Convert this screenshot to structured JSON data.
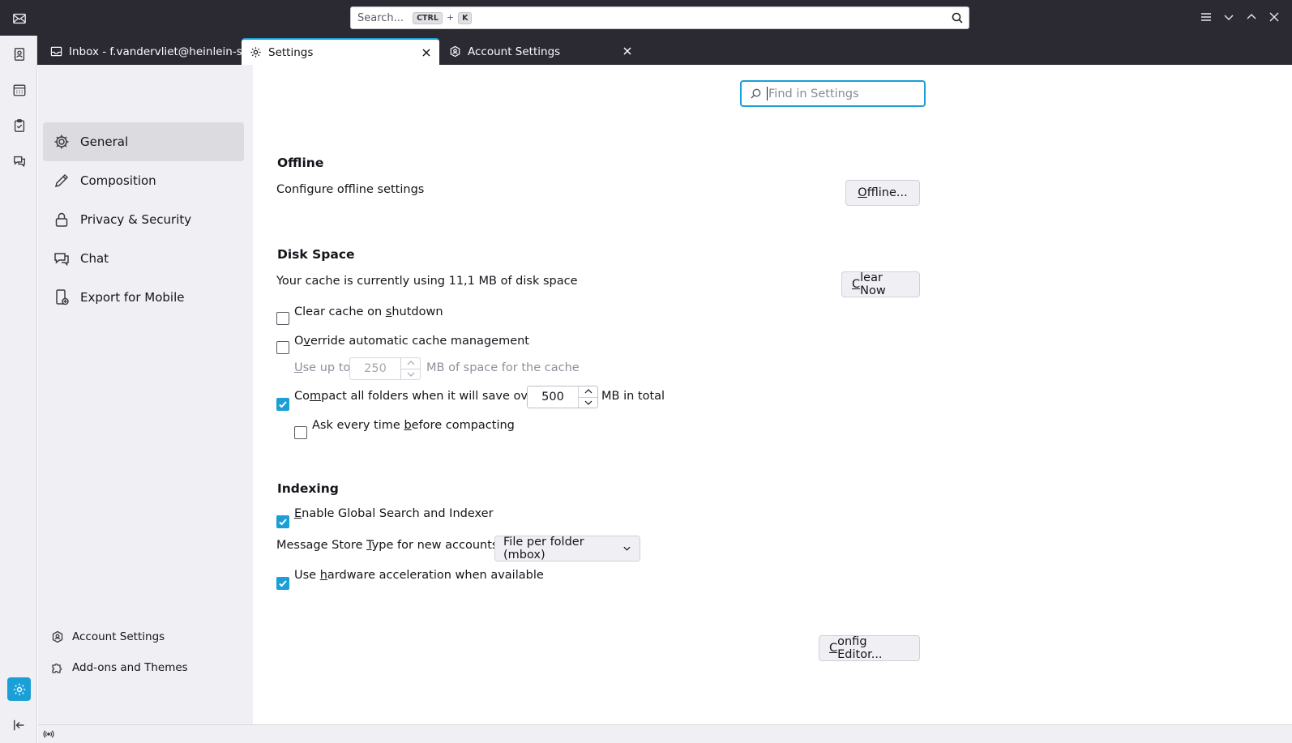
{
  "global_search": {
    "placeholder": "Search...",
    "shortcut_mod": "CTRL",
    "shortcut_plus": "+",
    "shortcut_key": "K"
  },
  "tabs": [
    {
      "label": "Inbox - f.vandervliet@heinlein-su"
    },
    {
      "label": "Settings"
    },
    {
      "label": "Account Settings"
    }
  ],
  "nav": {
    "items": [
      {
        "label": "General",
        "icon": "gear-icon"
      },
      {
        "label": "Composition",
        "icon": "pencil-icon"
      },
      {
        "label": "Privacy & Security",
        "icon": "lock-icon"
      },
      {
        "label": "Chat",
        "icon": "chat-icon"
      },
      {
        "label": "Export for Mobile",
        "icon": "mobile-export-icon"
      }
    ],
    "account_settings": "Account Settings",
    "addons": "Add-ons and Themes"
  },
  "find": {
    "placeholder": "Find in Settings"
  },
  "offline": {
    "title": "Offline",
    "desc": "Configure offline settings",
    "button_u": "O",
    "button_rest": "ffline..."
  },
  "disk": {
    "title": "Disk Space",
    "desc": "Your cache is currently using 11,1 MB of disk space",
    "clear_u": "C",
    "clear_rest": "lear Now",
    "clear_shutdown_a": "Clear cache on ",
    "clear_shutdown_u": "s",
    "clear_shutdown_b": "hutdown",
    "override_a": "O",
    "override_u": "v",
    "override_b": "erride automatic cache management",
    "use_up_u": "U",
    "use_up_b": "se up to",
    "cache_value": "250",
    "cache_suffix": "MB of space for the cache",
    "compact_a": "Co",
    "compact_u": "m",
    "compact_b": "pact all folders when it will save over",
    "compact_value": "500",
    "compact_suffix": "MB in total",
    "ask_a": "Ask every time ",
    "ask_u": "b",
    "ask_b": "efore compacting"
  },
  "indexing": {
    "title": "Indexing",
    "global_u": "E",
    "global_b": "nable Global Search and Indexer",
    "store_a": "Message Store ",
    "store_u": "T",
    "store_b": "ype for new accounts:",
    "store_value": "File per folder (mbox)",
    "hw_a": "Use ",
    "hw_u": "h",
    "hw_b": "ardware acceleration when available",
    "config_u": "C",
    "config_rest": "onfig Editor..."
  },
  "colors": {
    "accent": "#1a9fd6",
    "titlebar": "#2b2a33",
    "sidebar": "#f0f0f4"
  }
}
